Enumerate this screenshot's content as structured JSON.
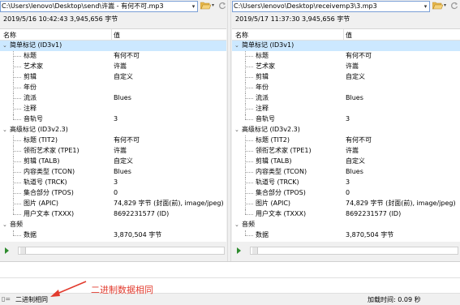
{
  "left": {
    "path": "C:\\Users\\lenovo\\Desktop\\send\\许嵩 - 有何不可.mp3",
    "info": "2019/5/16 10:42:43   3,945,656 字节"
  },
  "right": {
    "path": "C:\\Users\\lenovo\\Desktop\\receivemp3\\3.mp3",
    "info": "2019/5/17 11:37:30   3,945,656 字节"
  },
  "columns": {
    "name": "名称",
    "value": "值"
  },
  "tree": {
    "id3v1": {
      "label": "简单标记 (ID3v1)",
      "rows": [
        {
          "name": "标题",
          "value": "有何不可"
        },
        {
          "name": "艺术家",
          "value": "许嵩"
        },
        {
          "name": "剪辑",
          "value": "自定义"
        },
        {
          "name": "年份",
          "value": ""
        },
        {
          "name": "流派",
          "value": "Blues"
        },
        {
          "name": "注释",
          "value": ""
        },
        {
          "name": "音轨号",
          "value": "3"
        }
      ]
    },
    "id3v2": {
      "label": "高级标记 (ID3v2.3)",
      "rows": [
        {
          "name": "标题 (TIT2)",
          "value": "有何不可"
        },
        {
          "name": "领衔艺术家 (TPE1)",
          "value": "许嵩"
        },
        {
          "name": "剪辑 (TALB)",
          "value": "自定义"
        },
        {
          "name": "内容类型 (TCON)",
          "value": "Blues"
        },
        {
          "name": "轨道号 (TRCK)",
          "value": "3"
        },
        {
          "name": "集合部分 (TPOS)",
          "value": "0"
        },
        {
          "name": "图片 (APIC)",
          "value": "74,829 字节 (封面(前), image/jpeg)"
        },
        {
          "name": "用户文本 (TXXX)",
          "value": "8692231577 (ID)"
        }
      ]
    },
    "audio": {
      "label": "音频",
      "rows": [
        {
          "name": "数据",
          "value": "3,870,504 字节"
        }
      ]
    }
  },
  "status": {
    "result": "二进制相同",
    "load_time": "加载时间: 0.09 秒",
    "icon": "equals-icon"
  },
  "annotation": {
    "text": "二进制数据相同",
    "color": "#e23b2e"
  },
  "colors": {
    "selection": "#cce8ff",
    "play": "#2e8b2e",
    "folder": "#e8b84a"
  }
}
